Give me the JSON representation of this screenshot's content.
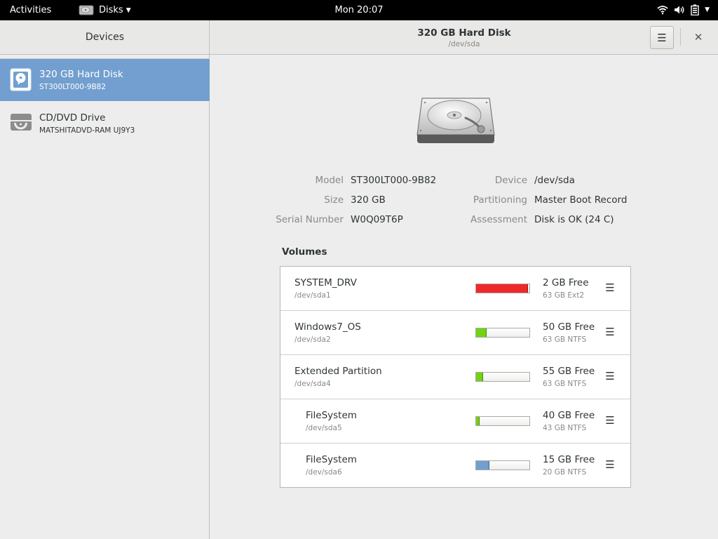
{
  "topbar": {
    "activities": "Activities",
    "app_name": "Disks",
    "app_icon": "disks-app-icon",
    "clock": "Mon 20:07",
    "status_icons": [
      "wifi-icon",
      "volume-icon",
      "battery-icon",
      "chevron-down-icon"
    ]
  },
  "sidebar": {
    "title": "Devices",
    "devices": [
      {
        "name": "320 GB Hard Disk",
        "subtitle": "ST300LT000-9B82",
        "icon": "hard-disk-icon",
        "selected": true
      },
      {
        "name": "CD/DVD Drive",
        "subtitle": "MATSHITADVD-RAM UJ9Y3",
        "icon": "optical-drive-icon",
        "selected": false
      }
    ]
  },
  "header": {
    "title": "320 GB Hard Disk",
    "subtitle": "/dev/sda",
    "menu_icon": "hamburger-menu-icon",
    "close_icon": "close-icon"
  },
  "disk_info": {
    "model_label": "Model",
    "model": "ST300LT000-9B82",
    "size_label": "Size",
    "size": "320 GB",
    "serial_label": "Serial Number",
    "serial": "W0Q09T6P",
    "device_label": "Device",
    "device": "/dev/sda",
    "partitioning_label": "Partitioning",
    "partitioning": "Master Boot Record",
    "assessment_label": "Assessment",
    "assessment": "Disk is OK (24 C)"
  },
  "volumes": {
    "heading": "Volumes",
    "items": [
      {
        "name": "SYSTEM_DRV",
        "device": "/dev/sda1",
        "free": "2 GB Free",
        "info": "63 GB Ext2",
        "used_fraction": 0.97,
        "color": "#ef2929",
        "indent": false
      },
      {
        "name": "Windows7_OS",
        "device": "/dev/sda2",
        "free": "50 GB Free",
        "info": "63 GB NTFS",
        "used_fraction": 0.2,
        "color": "#73d216",
        "indent": false
      },
      {
        "name": "Extended Partition",
        "device": "/dev/sda4",
        "free": "55 GB Free",
        "info": "63 GB NTFS",
        "used_fraction": 0.13,
        "color": "#73d216",
        "indent": false
      },
      {
        "name": "FileSystem",
        "device": "/dev/sda5",
        "free": "40 GB Free",
        "info": "43 GB NTFS",
        "used_fraction": 0.07,
        "color": "#73d216",
        "indent": true
      },
      {
        "name": "FileSystem",
        "device": "/dev/sda6",
        "free": "15 GB Free",
        "info": "20 GB NTFS",
        "used_fraction": 0.25,
        "color": "#729fcf",
        "indent": true
      }
    ]
  }
}
